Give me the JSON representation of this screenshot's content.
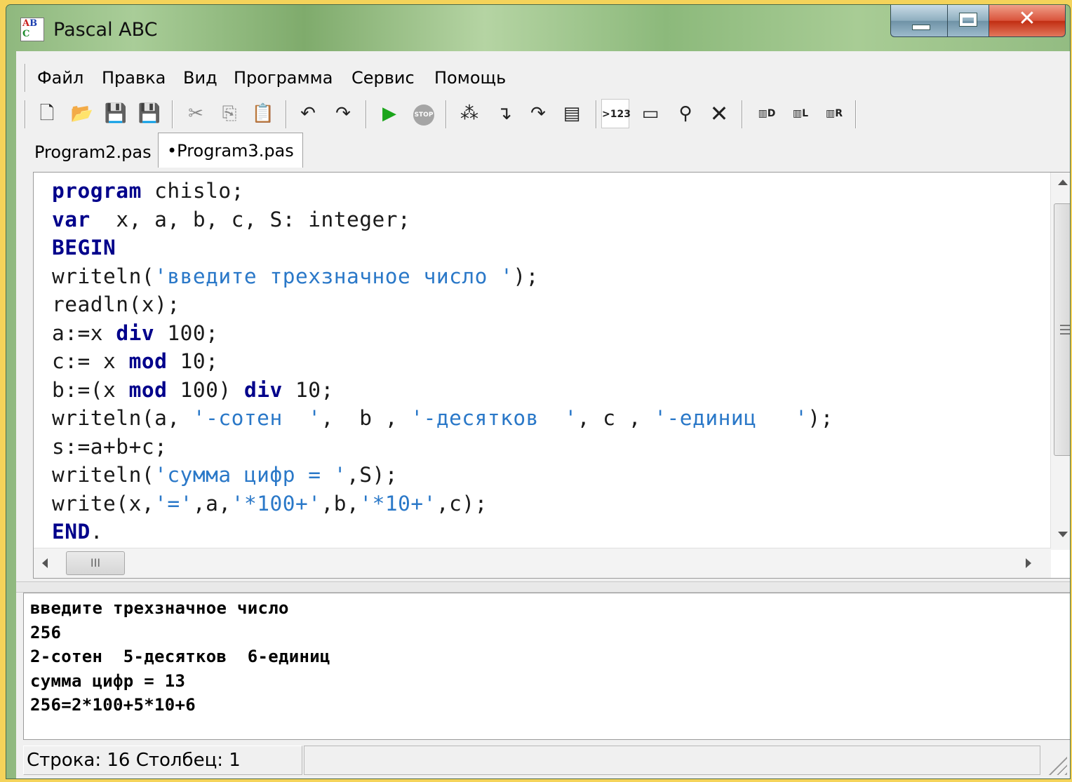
{
  "window": {
    "title": "Pascal ABC",
    "icon": "pascal-abc-icon"
  },
  "menu": [
    "Файл",
    "Правка",
    "Вид",
    "Программа",
    "Сервис",
    "Помощь"
  ],
  "toolbar": {
    "icons": [
      "new-file-icon",
      "open-folder-icon",
      "save-icon",
      "save-all-icon",
      "cut-icon",
      "copy-icon",
      "paste-icon",
      "undo-icon",
      "redo-icon",
      "run-icon",
      "stop-icon",
      "add-watch-icon",
      "step-into-icon",
      "step-over-icon",
      "evaluate-icon",
      "output-to-window-icon",
      "window-icon",
      "find-icon",
      "close-icon",
      "dll-icon",
      "lib-icon",
      "reference-icon"
    ],
    "output_label": ">123"
  },
  "tabs": [
    {
      "label": "Program2.pas",
      "active": false
    },
    {
      "label": "•Program3.pas",
      "active": true
    }
  ],
  "code": [
    [
      [
        "kw",
        "program"
      ],
      [
        "p",
        " chislo;"
      ]
    ],
    [
      [
        "kw",
        "var"
      ],
      [
        "p",
        "  x, a, b, c, S: integer;"
      ]
    ],
    [
      [
        "kw",
        "BEGIN"
      ]
    ],
    [
      [
        "p",
        "writeln("
      ],
      [
        "str",
        "'введите трехзначное число '"
      ],
      [
        "p",
        ");"
      ]
    ],
    [
      [
        "p",
        "readln(x);"
      ]
    ],
    [
      [
        "p",
        "a:=x "
      ],
      [
        "kw",
        "div"
      ],
      [
        "p",
        " 100;"
      ]
    ],
    [
      [
        "p",
        "c:= x "
      ],
      [
        "kw",
        "mod"
      ],
      [
        "p",
        " 10;"
      ]
    ],
    [
      [
        "p",
        "b:=(x "
      ],
      [
        "kw",
        "mod"
      ],
      [
        "p",
        " 100) "
      ],
      [
        "kw",
        "div"
      ],
      [
        "p",
        " 10;"
      ]
    ],
    [
      [
        "p",
        "writeln(a, "
      ],
      [
        "str",
        "'-сотен  '"
      ],
      [
        "p",
        ",  b , "
      ],
      [
        "str",
        "'-десятков  '"
      ],
      [
        "p",
        ", c , "
      ],
      [
        "str",
        "'-единиц   '"
      ],
      [
        "p",
        ");"
      ]
    ],
    [
      [
        "p",
        "s:=a+b+c;"
      ]
    ],
    [
      [
        "p",
        "writeln("
      ],
      [
        "str",
        "'сумма цифр = '"
      ],
      [
        "p",
        ",S);"
      ]
    ],
    [
      [
        "p",
        "write(x,"
      ],
      [
        "str",
        "'='"
      ],
      [
        "p",
        ",a,"
      ],
      [
        "str",
        "'*100+'"
      ],
      [
        "p",
        ",b,"
      ],
      [
        "str",
        "'*10+'"
      ],
      [
        "p",
        ",c);"
      ]
    ],
    [
      [
        "kw",
        "END"
      ],
      [
        "p",
        "."
      ]
    ]
  ],
  "hscroll_grip": "III",
  "output": [
    "введите трехзначное число",
    "256",
    "2-сотен  5-десятков  6-единиц",
    "сумма цифр = 13",
    "256=2*100+5*10+6"
  ],
  "status": {
    "text": "Строка: 16    Столбец: 1"
  },
  "colors": {
    "keyword": "#00008b",
    "string": "#2a78c8",
    "text": "#1a1a1a"
  }
}
